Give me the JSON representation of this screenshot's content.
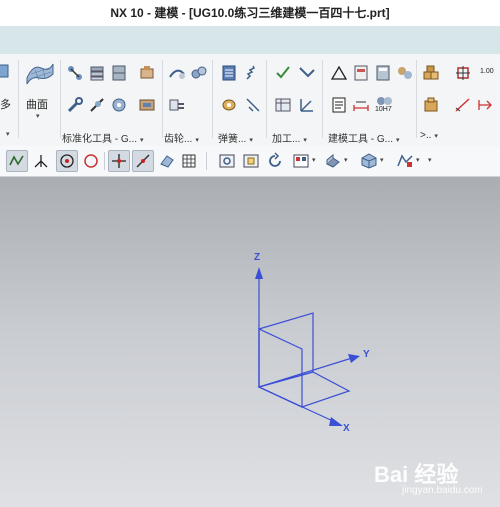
{
  "window": {
    "title": "NX 10 - 建模 - [UG10.0练习三维建模一百四十七.prt]"
  },
  "ribbon": {
    "left_partial_label": "多",
    "surface_label": "曲面",
    "groups": [
      {
        "label": "标准化工具 - G..."
      },
      {
        "label": "齿轮..."
      },
      {
        "label": "弹簧..."
      },
      {
        "label": "加工..."
      },
      {
        "label": "建模工具 - G..."
      },
      {
        "label": ">.."
      }
    ],
    "fit_tolerance_label": "10H7",
    "value_label": "1.00"
  },
  "viewport": {
    "axes": {
      "x": "X",
      "y": "Y",
      "z": "Z"
    },
    "csys_color": "#3b4fd6"
  },
  "watermark": {
    "brand": "Bai 经验",
    "url": "jingyan.baidu.com"
  }
}
